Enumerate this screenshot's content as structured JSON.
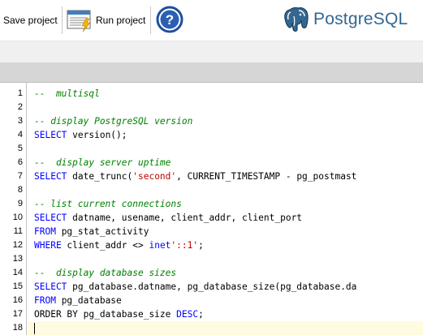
{
  "toolbar": {
    "save_label": "Save project",
    "run_label": "Run project"
  },
  "logo": {
    "text": "PostgreSQL"
  },
  "editor": {
    "current_line": 18,
    "lines": [
      {
        "n": "1",
        "tokens": [
          {
            "t": "--  multisql",
            "c": "comment"
          }
        ]
      },
      {
        "n": "2",
        "tokens": []
      },
      {
        "n": "3",
        "tokens": [
          {
            "t": "-- display PostgreSQL version",
            "c": "comment"
          }
        ]
      },
      {
        "n": "4",
        "tokens": [
          {
            "t": "SELECT",
            "c": "keyword"
          },
          {
            "t": " version();",
            "c": "plain"
          }
        ]
      },
      {
        "n": "5",
        "tokens": []
      },
      {
        "n": "6",
        "tokens": [
          {
            "t": "--  display server uptime",
            "c": "comment"
          }
        ]
      },
      {
        "n": "7",
        "tokens": [
          {
            "t": "SELECT",
            "c": "keyword"
          },
          {
            "t": " date_trunc(",
            "c": "plain"
          },
          {
            "t": "'second'",
            "c": "string"
          },
          {
            "t": ", CURRENT_TIMESTAMP - pg_postmast",
            "c": "plain"
          }
        ]
      },
      {
        "n": "8",
        "tokens": []
      },
      {
        "n": "9",
        "tokens": [
          {
            "t": "-- list current connections",
            "c": "comment"
          }
        ]
      },
      {
        "n": "10",
        "tokens": [
          {
            "t": "SELECT",
            "c": "keyword"
          },
          {
            "t": " datname, usename, client_addr, client_port",
            "c": "plain"
          }
        ]
      },
      {
        "n": "11",
        "tokens": [
          {
            "t": "FROM",
            "c": "keyword"
          },
          {
            "t": " pg_stat_activity",
            "c": "plain"
          }
        ]
      },
      {
        "n": "12",
        "tokens": [
          {
            "t": "WHERE",
            "c": "keyword"
          },
          {
            "t": " client_addr <> ",
            "c": "plain"
          },
          {
            "t": "inet",
            "c": "keyword"
          },
          {
            "t": "'::1'",
            "c": "string"
          },
          {
            "t": ";",
            "c": "plain"
          }
        ]
      },
      {
        "n": "13",
        "tokens": []
      },
      {
        "n": "14",
        "tokens": [
          {
            "t": "--  display database sizes",
            "c": "comment"
          }
        ]
      },
      {
        "n": "15",
        "tokens": [
          {
            "t": "SELECT",
            "c": "keyword"
          },
          {
            "t": " pg_database.datname, pg_database_size(pg_database.da",
            "c": "plain"
          }
        ]
      },
      {
        "n": "16",
        "tokens": [
          {
            "t": "FROM",
            "c": "keyword"
          },
          {
            "t": " pg_database",
            "c": "plain"
          }
        ]
      },
      {
        "n": "17",
        "tokens": [
          {
            "t": "ORDER BY pg_database_size ",
            "c": "plain"
          },
          {
            "t": "DESC",
            "c": "keyword"
          },
          {
            "t": ";",
            "c": "plain"
          }
        ]
      },
      {
        "n": "18",
        "tokens": []
      }
    ]
  },
  "icons": {
    "save": "save-icon",
    "run": "run-project-icon",
    "help": "help-icon",
    "logo": "postgresql-elephant-icon"
  },
  "colors": {
    "comment": "#008000",
    "keyword": "#0000ff",
    "string": "#c00000",
    "logo": "#336791",
    "help": "#1e4f9c"
  }
}
